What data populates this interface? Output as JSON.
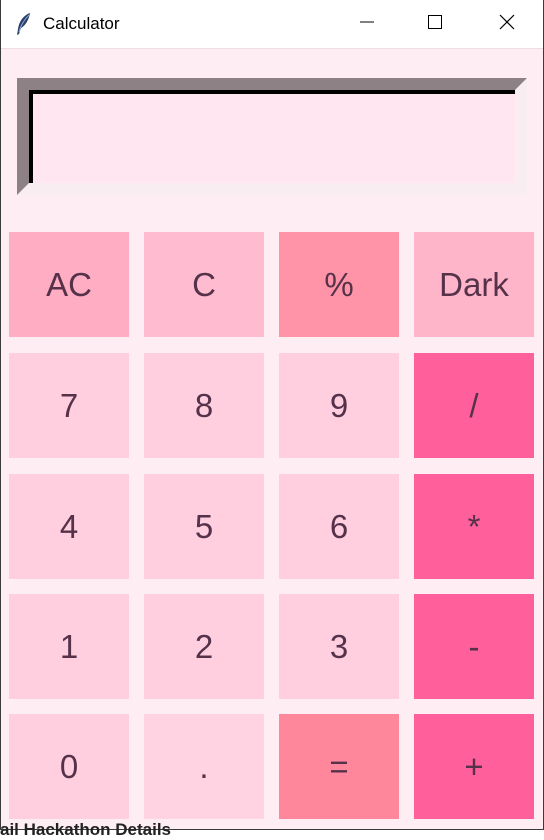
{
  "window": {
    "title": "Calculator",
    "icon": "feather-icon",
    "controls": [
      "minimize-icon",
      "maximize-icon",
      "close-icon"
    ]
  },
  "display": {
    "value": ""
  },
  "keys": [
    [
      "AC",
      "C",
      "%",
      "Dark"
    ],
    [
      "7",
      "8",
      "9",
      "/"
    ],
    [
      "4",
      "5",
      "6",
      "*"
    ],
    [
      "1",
      "2",
      "3",
      "-"
    ],
    [
      "0",
      ".",
      "=",
      "+"
    ]
  ],
  "colors": {
    "background": "#feeef4",
    "display_bg": "#ffe6f0",
    "operator": "#ff5f9a",
    "equals": "#ff879c",
    "number": "#ffcfdf",
    "text": "#55324a"
  },
  "background_window_text": "ail Hackathon Details"
}
